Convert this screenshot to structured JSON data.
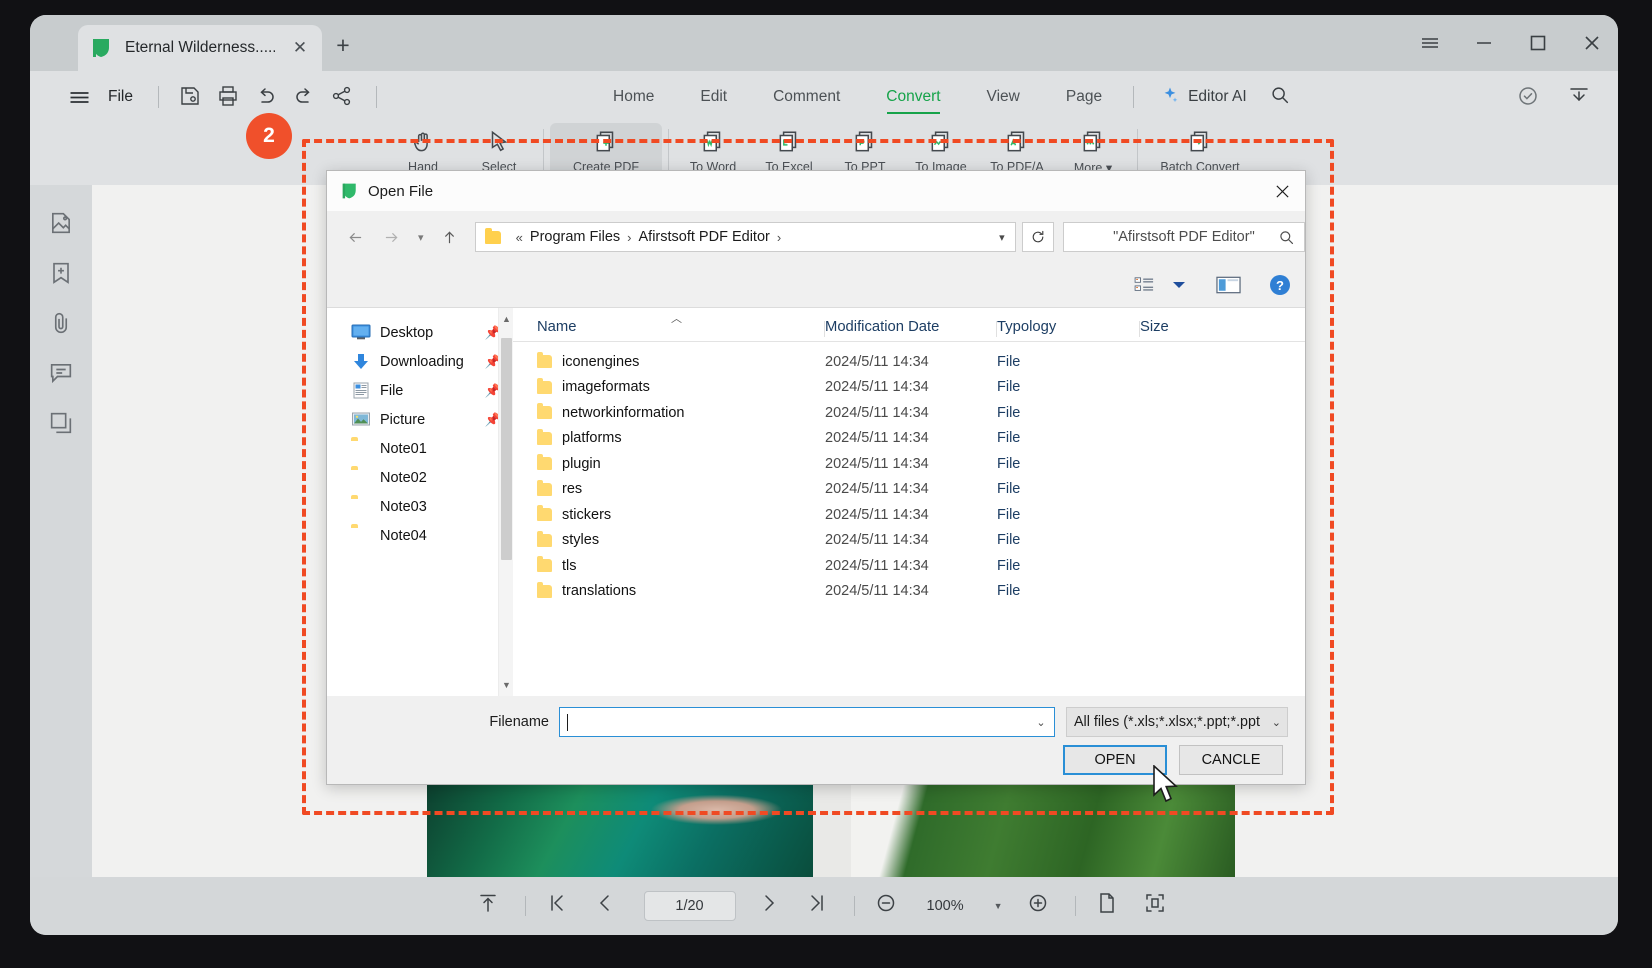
{
  "app": {
    "tab": {
      "title": "Eternal Wilderness......",
      "close_icon": "close-icon",
      "new_tab_icon": "plus-icon"
    },
    "window_controls": [
      {
        "name": "menu-hamburger-icon",
        "glyph": "☰"
      },
      {
        "name": "minimize-icon",
        "glyph": "—"
      },
      {
        "name": "maximize-icon",
        "glyph": "▢"
      },
      {
        "name": "close-window-icon",
        "glyph": "✕"
      }
    ],
    "menu": {
      "file_label": "File",
      "quick_tools": [
        "save-icon",
        "print-icon",
        "undo-icon",
        "redo-icon",
        "share-icon"
      ],
      "right_tools": [
        "cloud-check-icon",
        "collapse-ribbon-icon"
      ]
    },
    "ribbon_tabs": [
      {
        "label": "Home",
        "active": false
      },
      {
        "label": "Edit",
        "active": false
      },
      {
        "label": "Comment",
        "active": false
      },
      {
        "label": "Convert",
        "active": true
      },
      {
        "label": "View",
        "active": false
      },
      {
        "label": "Page",
        "active": false
      }
    ],
    "editor_ai": {
      "label": "Editor AI",
      "icon": "sparkle-icon"
    },
    "search_icon": "search-icon",
    "ribbon_items": [
      {
        "label": "Hand",
        "icon": "hand-icon",
        "selected": false
      },
      {
        "label": "Select",
        "icon": "cursor-icon",
        "selected": false
      },
      {
        "label": "Create PDF",
        "icon": "create-pdf-icon",
        "selected": true
      },
      {
        "label": "To Word",
        "icon": "to-word-icon",
        "selected": false
      },
      {
        "label": "To Excel",
        "icon": "to-excel-icon",
        "selected": false
      },
      {
        "label": "To PPT",
        "icon": "to-ppt-icon",
        "selected": false
      },
      {
        "label": "To Image",
        "icon": "to-image-icon",
        "selected": false
      },
      {
        "label": "To PDF/A",
        "icon": "to-pdfa-icon",
        "selected": false
      },
      {
        "label": "More ▾",
        "icon": "more-icon",
        "selected": false
      },
      {
        "label": "Batch Convert",
        "icon": "batch-convert-icon",
        "selected": false
      }
    ],
    "rail_icons": [
      "thumbnail-icon",
      "bookmark-add-icon",
      "attachment-icon",
      "comment-icon",
      "layers-icon"
    ],
    "bottombar": {
      "fit_top_icon": "fit-page-top-icon",
      "first_page_icon": "first-page-icon",
      "prev_page_icon": "previous-page-icon",
      "page_indicator": "1/20",
      "next_page_icon": "next-page-icon",
      "last_page_icon": "last-page-icon",
      "zoom_out_icon": "zoom-out-icon",
      "zoom_level": "100%",
      "zoom_in_icon": "zoom-in-icon",
      "single_page_icon": "single-page-icon",
      "fit_screen_icon": "fit-screen-icon"
    }
  },
  "annotation": {
    "step_number": "2",
    "badge_color": "#f0502b",
    "highlight_color": "#f04a23"
  },
  "dialog": {
    "title": "Open File",
    "logo_icon": "afirstsoft-logo-icon",
    "close_icon": "close-icon",
    "nav": {
      "back_icon": "arrow-left-icon",
      "forward_icon": "arrow-right-icon",
      "recent_icon": "chevron-down-icon",
      "up_icon": "arrow-up-icon",
      "breadcrumb": [
        "Program Files",
        "Afirstsoft PDF Editor"
      ],
      "breadcrumb_prefix": "«",
      "breadcrumb_dropdown_icon": "chevron-down-icon",
      "refresh_icon": "refresh-icon",
      "search_value": "\"Afirstsoft PDF Editor\"",
      "search_icon": "search-icon"
    },
    "toolbar": {
      "view_list_icon": "view-options-icon",
      "view_dropdown_icon": "caret-down-icon",
      "preview_pane_icon": "preview-pane-icon",
      "help_icon": "help-icon"
    },
    "places": [
      {
        "label": "Desktop",
        "icon": "desktop-icon",
        "pinned": true
      },
      {
        "label": "Downloading",
        "icon": "download-icon",
        "pinned": true
      },
      {
        "label": "File",
        "icon": "document-icon",
        "pinned": true
      },
      {
        "label": "Picture",
        "icon": "picture-icon",
        "pinned": true
      },
      {
        "label": "Note01",
        "icon": "folder-icon",
        "pinned": false
      },
      {
        "label": "Note02",
        "icon": "folder-icon",
        "pinned": false
      },
      {
        "label": "Note03",
        "icon": "folder-icon",
        "pinned": false
      },
      {
        "label": "Note04",
        "icon": "folder-icon",
        "pinned": false
      }
    ],
    "columns": [
      "Name",
      "Modification Date",
      "Typology",
      "Size"
    ],
    "sort_indicator": "ascending",
    "files": [
      {
        "name": "iconengines",
        "date": "2024/5/11 14:34",
        "type": "File",
        "size": ""
      },
      {
        "name": "imageformats",
        "date": "2024/5/11 14:34",
        "type": "File",
        "size": ""
      },
      {
        "name": "networkinformation",
        "date": "2024/5/11 14:34",
        "type": "File",
        "size": ""
      },
      {
        "name": "platforms",
        "date": "2024/5/11 14:34",
        "type": "File",
        "size": ""
      },
      {
        "name": "plugin",
        "date": "2024/5/11 14:34",
        "type": "File",
        "size": ""
      },
      {
        "name": "res",
        "date": "2024/5/11 14:34",
        "type": "File",
        "size": ""
      },
      {
        "name": "stickers",
        "date": "2024/5/11 14:34",
        "type": "File",
        "size": ""
      },
      {
        "name": "styles",
        "date": "2024/5/11 14:34",
        "type": "File",
        "size": ""
      },
      {
        "name": "tls",
        "date": "2024/5/11 14:34",
        "type": "File",
        "size": ""
      },
      {
        "name": "translations",
        "date": "2024/5/11 14:34",
        "type": "File",
        "size": ""
      }
    ],
    "footer": {
      "filename_label": "Filename",
      "filename_value": "",
      "filename_dropdown_icon": "chevron-down-icon",
      "filter_value": "All files (*.xls;*.xlsx;*.ppt;*.ppt",
      "filter_caret_icon": "chevron-down-icon",
      "open_label": "OPEN",
      "cancel_label": "CANCLE"
    }
  }
}
